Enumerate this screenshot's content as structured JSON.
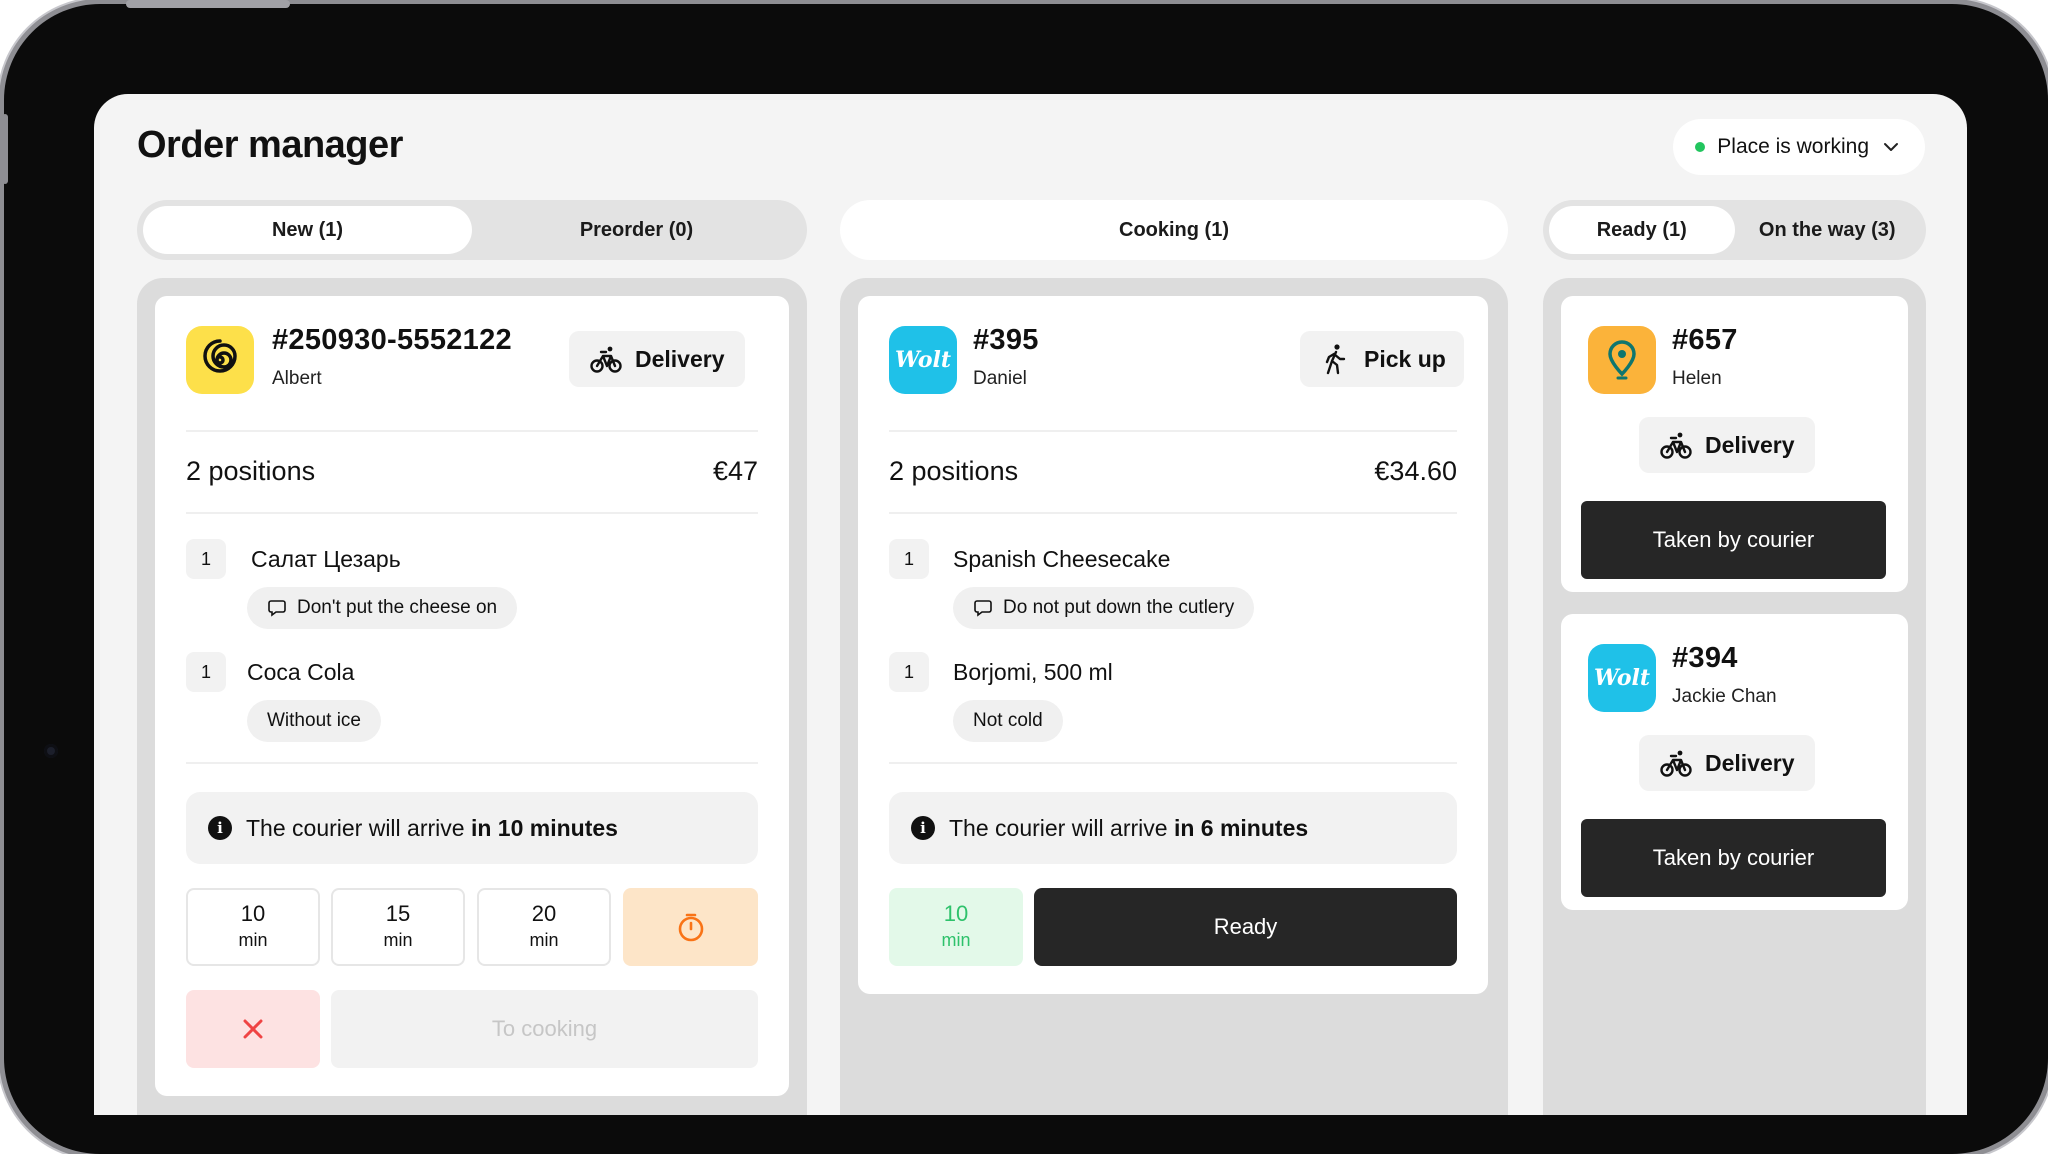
{
  "header": {
    "title": "Order manager",
    "status_label": "Place is working",
    "status_color": "#22c55e"
  },
  "tabs": {
    "new": "New (1)",
    "preorder": "Preorder (0)",
    "cooking": "Cooking (1)",
    "ready": "Ready (1)",
    "on_the_way": "On the way (3)"
  },
  "new_order": {
    "number": "#250930-5552122",
    "customer": "Albert",
    "service_icon": "spiral-logo-icon",
    "type_label": "Delivery",
    "positions": "2 positions",
    "total": "€47",
    "items": [
      {
        "qty": "1",
        "name": "Салат Цезарь",
        "note": "Don't put the cheese on"
      },
      {
        "qty": "1",
        "name": "Coca Cola",
        "note": "Without ice"
      }
    ],
    "courier_text": "The courier will arrive",
    "courier_eta": "in 10 minutes",
    "time_options": [
      {
        "value": "10",
        "unit": "min"
      },
      {
        "value": "15",
        "unit": "min"
      },
      {
        "value": "20",
        "unit": "min"
      }
    ],
    "to_cooking_label": "To cooking"
  },
  "cooking_order": {
    "number": "#395",
    "customer": "Daniel",
    "service_logo_text": "Wolt",
    "type_label": "Pick up",
    "positions": "2 positions",
    "total": "€34.60",
    "items": [
      {
        "qty": "1",
        "name": "Spanish Cheesecake",
        "note": "Do not put down the cutlery"
      },
      {
        "qty": "1",
        "name": "Borjomi, 500 ml",
        "note": "Not cold"
      }
    ],
    "courier_text": "The courier will arrive",
    "courier_eta": "in 6 minutes",
    "timer_value": "10",
    "timer_unit": "min",
    "ready_label": "Ready"
  },
  "ready_orders": [
    {
      "number": "#657",
      "customer": "Helen",
      "service_icon": "map-pin-logo-icon",
      "type_label": "Delivery",
      "action": "Taken by courier"
    },
    {
      "number": "#394",
      "customer": "Jackie Chan",
      "service_logo_text": "Wolt",
      "type_label": "Delivery",
      "action": "Taken by courier"
    }
  ],
  "colors": {
    "yellow_logo": "#fde04a",
    "wolt_logo": "#1fc1e8",
    "orange_logo": "#fbb33a",
    "timer_bg": "#fde5c8",
    "timer_icon": "#f97316",
    "cancel_bg": "#fde2e2",
    "cancel_icon": "#ef4444",
    "green_text": "#2ec26b"
  }
}
